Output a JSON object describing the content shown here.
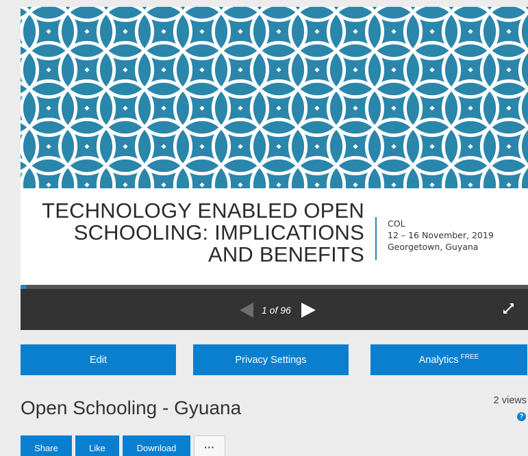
{
  "slide": {
    "title_lines": [
      "TECHNOLOGY ENABLED OPEN",
      "SCHOOLING: IMPLICATIONS",
      "AND BENEFITS"
    ],
    "meta_lines": [
      "COL",
      "12 – 16 November, 2019",
      "Georgetown, Guyana"
    ],
    "pattern_color": "#2b86ab"
  },
  "player": {
    "page_counter": "1 of 96",
    "current_page": 1,
    "total_pages": 96,
    "progress_fraction": 0.0104
  },
  "actions": {
    "edit_label": "Edit",
    "privacy_label": "Privacy Settings",
    "analytics_label": "Analytics",
    "analytics_badge": "FREE"
  },
  "document": {
    "title": "Open Schooling - Gyuana",
    "views": "2 views",
    "help_glyph": "?"
  },
  "share_row": {
    "share_label": "Share",
    "like_label": "Like",
    "download_label": "Download",
    "more_label": "···"
  },
  "colors": {
    "accent_blue": "#0a7fd0",
    "player_bg": "#333333",
    "page_bg": "#ececec"
  }
}
